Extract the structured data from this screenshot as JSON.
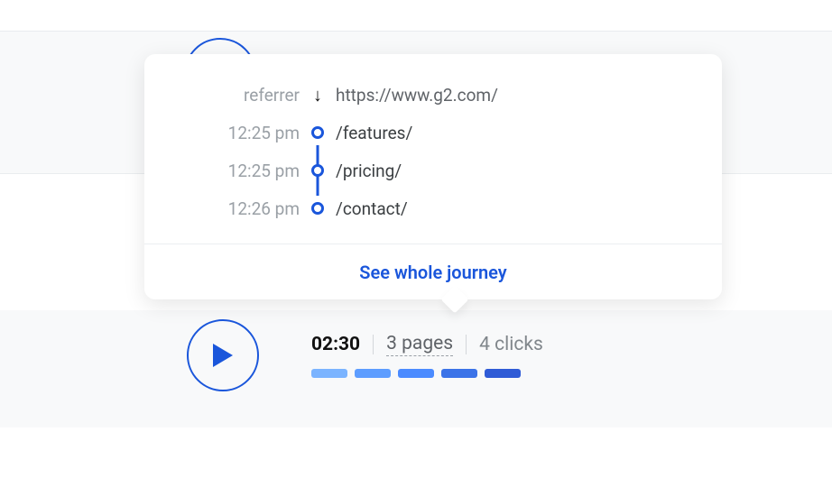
{
  "journey": {
    "referrer_label": "referrer",
    "referrer_url": "https://www.g2.com/",
    "steps": [
      {
        "time": "12:25 pm",
        "path": "/features/"
      },
      {
        "time": "12:25 pm",
        "path": "/pricing/"
      },
      {
        "time": "12:26 pm",
        "path": "/contact/"
      }
    ],
    "cta": "See whole journey"
  },
  "summary": {
    "duration": "02:30",
    "pages": "3 pages",
    "clicks": "4 clicks",
    "segment_colors": [
      "#7bb4ff",
      "#5d9dff",
      "#4b8bff",
      "#3b73e8",
      "#2f5bd6"
    ]
  }
}
